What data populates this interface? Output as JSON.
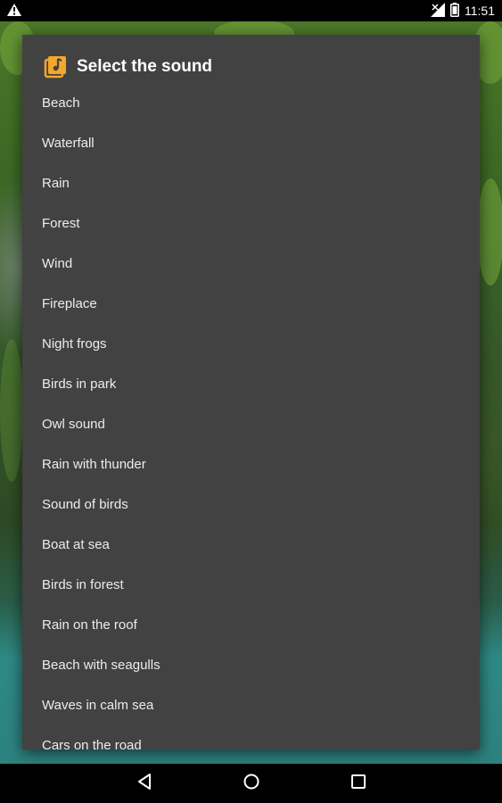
{
  "status_bar": {
    "time": "11:51",
    "icons": [
      "warning-icon",
      "signal-icon",
      "battery-icon"
    ]
  },
  "dialog": {
    "title": "Select the sound",
    "icon": "music-note-icon",
    "accent_color": "#f3a72b",
    "items": [
      "Beach",
      "Waterfall",
      "Rain",
      "Forest",
      "Wind",
      "Fireplace",
      "Night frogs",
      "Birds in park",
      "Owl sound",
      "Rain with thunder",
      "Sound of birds",
      "Boat at sea",
      "Birds in forest",
      "Rain on the roof",
      "Beach with seagulls",
      "Waves in calm sea",
      "Cars on the road"
    ]
  },
  "nav_bar": {
    "buttons": [
      "back-icon",
      "home-icon",
      "recents-icon"
    ]
  }
}
